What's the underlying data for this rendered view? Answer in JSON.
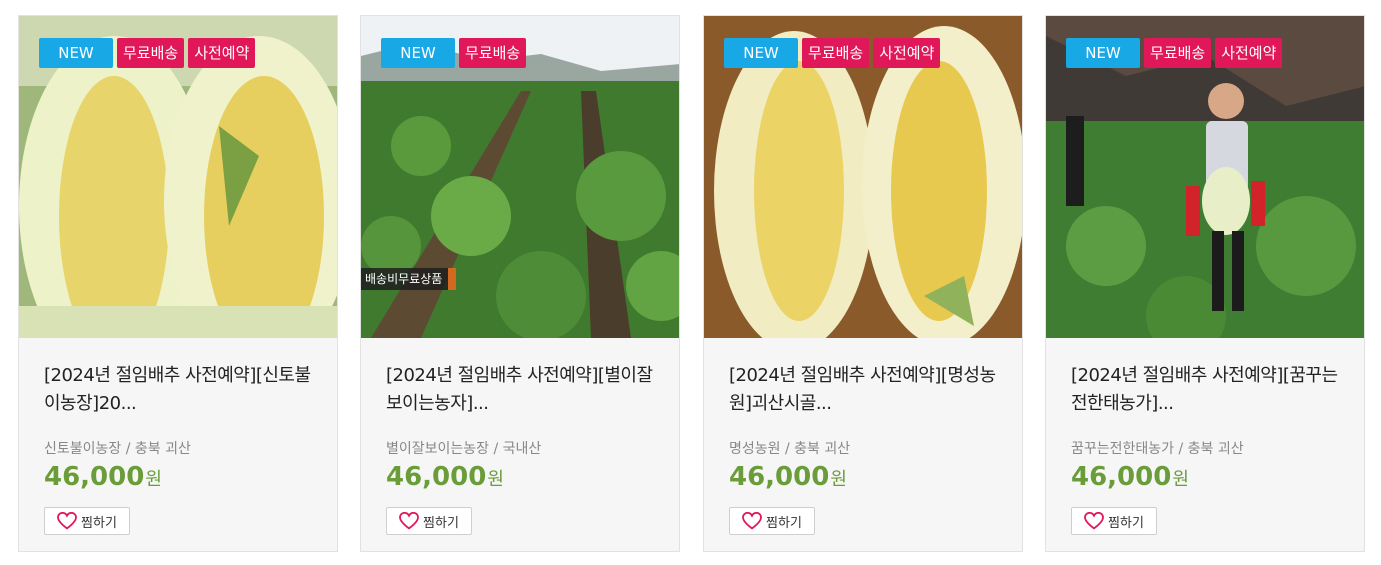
{
  "products": [
    {
      "badges": [
        "NEW",
        "무료배송",
        "사전예약"
      ],
      "title": "[2024년 절임배추 사전예약][신토불이농장]20...",
      "farm": "신토불이농장 / 충북 괴산",
      "price": "46,000",
      "currency": "원",
      "wish_label": "찜하기"
    },
    {
      "badges": [
        "NEW",
        "무료배송"
      ],
      "watermark": "배송비무료상품",
      "title": "[2024년 절임배추 사전예약][별이잘보이는농자]...",
      "farm": "별이잘보이는농장 / 국내산",
      "price": "46,000",
      "currency": "원",
      "wish_label": "찜하기"
    },
    {
      "badges": [
        "NEW",
        "무료배송",
        "사전예약"
      ],
      "title": "[2024년 절임배추 사전예약][명성농원]괴산시골...",
      "farm": "명성농원 / 충북 괴산",
      "price": "46,000",
      "currency": "원",
      "wish_label": "찜하기"
    },
    {
      "badges": [
        "NEW",
        "무료배송",
        "사전예약"
      ],
      "title": "[2024년 절임배추 사전예약][꿈꾸는전한태농가]...",
      "farm": "꿈꾸는전한태농가 / 충북 괴산",
      "price": "46,000",
      "currency": "원",
      "wish_label": "찜하기"
    }
  ],
  "colors": {
    "new_badge": "#19a8e6",
    "red_badge": "#e0185a",
    "price": "#6a9d3a",
    "heart": "#e0185a"
  },
  "icons": {
    "wish": "heart-icon"
  }
}
